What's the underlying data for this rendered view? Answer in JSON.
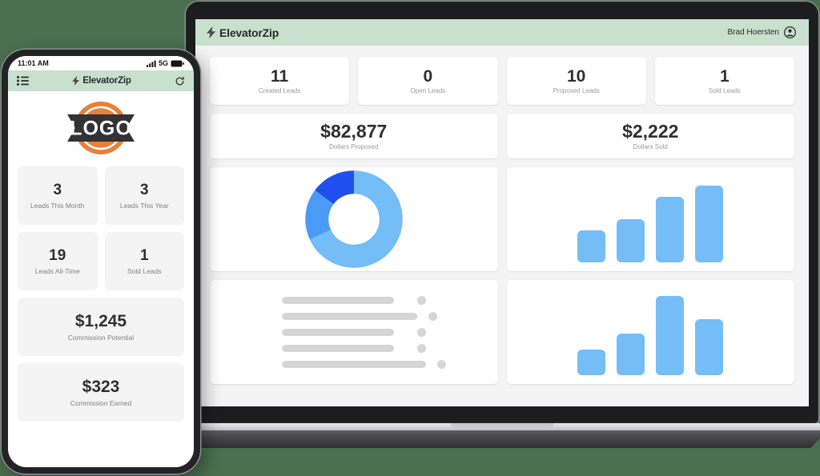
{
  "theme": {
    "page_background": "#4a6e4f",
    "header_green": "#c8e0cd",
    "bar_blue": "#74bdf7",
    "donut_mid_blue": "#4a9bf5",
    "donut_dark_blue": "#1f50ee",
    "skeleton_gray": "#d6d6d6",
    "logo_orange": "#e8803a"
  },
  "laptop": {
    "header": {
      "bolt_icon": "lightning-bolt-icon",
      "brand": "ElevatorZip",
      "user_name": "Brad Hoersten",
      "avatar_icon": "user-avatar-icon"
    },
    "stats": [
      {
        "value": "11",
        "label": "Created Leads"
      },
      {
        "value": "0",
        "label": "Open Leads"
      },
      {
        "value": "10",
        "label": "Proposed Leads"
      },
      {
        "value": "1",
        "label": "Sold Leads"
      }
    ],
    "money": [
      {
        "value": "$82,877",
        "label": "Dollars Proposed"
      },
      {
        "value": "$2,222",
        "label": "Dollars Sold"
      }
    ],
    "skeleton_rows": [
      {
        "bar_width": "78%"
      },
      {
        "bar_width": "94%"
      },
      {
        "bar_width": "78%"
      },
      {
        "bar_width": "78%"
      },
      {
        "bar_width": "100%"
      }
    ]
  },
  "phone": {
    "status_bar": {
      "time": "11:01 AM",
      "signal_icon": "cellular-signal-icon",
      "network": "5G",
      "battery_icon": "battery-full-icon"
    },
    "header": {
      "menu_icon": "list-menu-icon",
      "bolt_icon": "lightning-bolt-icon",
      "brand": "ElevatorZip",
      "refresh_icon": "refresh-icon"
    },
    "logo": {
      "icon": "logo-badge-icon",
      "text": "LOGO"
    },
    "cards": [
      {
        "value": "3",
        "label": "Leads This Month"
      },
      {
        "value": "3",
        "label": "Leads This Year"
      },
      {
        "value": "19",
        "label": "Leads All-Time"
      },
      {
        "value": "1",
        "label": "Sold Leads"
      },
      {
        "value": "$1,245",
        "label": "Commission Potential"
      },
      {
        "value": "$323",
        "label": "Commission Earned"
      }
    ]
  },
  "chart_data": [
    {
      "type": "pie",
      "title": "",
      "variant": "donut",
      "labels": [
        "Segment 1",
        "Segment 2",
        "Segment 3"
      ],
      "values": [
        68,
        17,
        15
      ],
      "colors": [
        "#74bdf7",
        "#4a9bf5",
        "#1f50ee"
      ],
      "legend": "none"
    },
    {
      "type": "bar",
      "title": "",
      "categories": [
        "1",
        "2",
        "3",
        "4"
      ],
      "values": [
        37,
        50,
        76,
        89
      ],
      "xlabel": "",
      "ylabel": "",
      "ylim": [
        0,
        100
      ],
      "grid": false,
      "color": "#74bdf7"
    },
    {
      "type": "bar",
      "title": "",
      "categories": [
        "1",
        "2",
        "3",
        "4"
      ],
      "values": [
        30,
        48,
        92,
        65
      ],
      "xlabel": "",
      "ylabel": "",
      "ylim": [
        0,
        100
      ],
      "grid": false,
      "color": "#74bdf7"
    }
  ]
}
